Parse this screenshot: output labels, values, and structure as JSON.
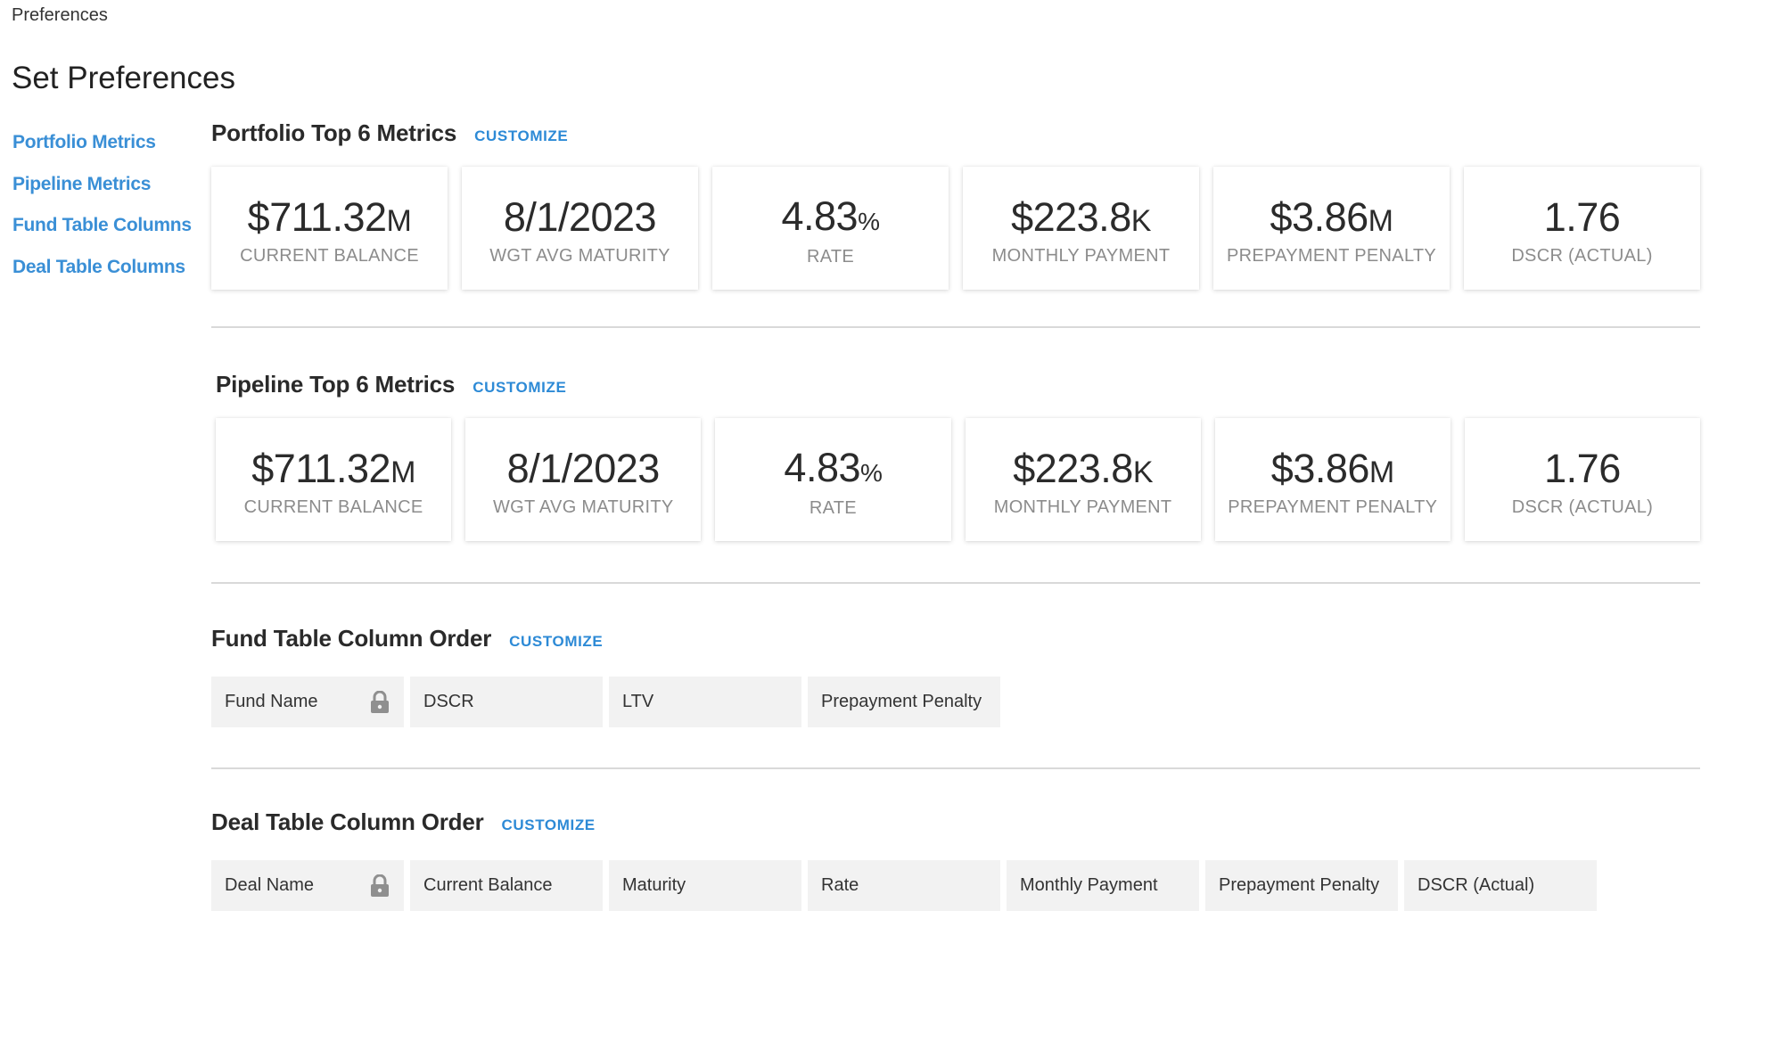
{
  "app": {
    "title": "Preferences"
  },
  "page": {
    "title": "Set Preferences"
  },
  "sidebar": {
    "items": [
      {
        "label": "Portfolio Metrics"
      },
      {
        "label": "Pipeline Metrics"
      },
      {
        "label": "Fund Table Columns"
      },
      {
        "label": "Deal Table Columns"
      }
    ]
  },
  "portfolio": {
    "title": "Portfolio Top 6 Metrics",
    "customize_label": "CUSTOMIZE",
    "metrics": [
      {
        "value": "$711.32",
        "suffix": "M",
        "label": "CURRENT BALANCE"
      },
      {
        "value": "8/1/2023",
        "suffix": "",
        "label": "WGT AVG MATURITY"
      },
      {
        "value": "4.83",
        "suffix": "%",
        "label": "RATE"
      },
      {
        "value": "$223.8",
        "suffix": "K",
        "label": "MONTHLY PAYMENT"
      },
      {
        "value": "$3.86",
        "suffix": "M",
        "label": "PREPAYMENT PENALTY"
      },
      {
        "value": "1.76",
        "suffix": "",
        "label": "DSCR (ACTUAL)"
      }
    ]
  },
  "pipeline": {
    "title": "Pipeline Top 6 Metrics",
    "customize_label": "CUSTOMIZE",
    "metrics": [
      {
        "value": "$711.32",
        "suffix": "M",
        "label": "CURRENT BALANCE"
      },
      {
        "value": "8/1/2023",
        "suffix": "",
        "label": "WGT AVG MATURITY"
      },
      {
        "value": "4.83",
        "suffix": "%",
        "label": "RATE"
      },
      {
        "value": "$223.8",
        "suffix": "K",
        "label": "MONTHLY PAYMENT"
      },
      {
        "value": "$3.86",
        "suffix": "M",
        "label": "PREPAYMENT PENALTY"
      },
      {
        "value": "1.76",
        "suffix": "",
        "label": "DSCR (ACTUAL)"
      }
    ]
  },
  "fund_columns": {
    "title": "Fund Table Column Order",
    "customize_label": "CUSTOMIZE",
    "columns": [
      {
        "label": "Fund Name",
        "locked": true,
        "icon": "lock-icon"
      },
      {
        "label": "DSCR",
        "locked": false
      },
      {
        "label": "LTV",
        "locked": false
      },
      {
        "label": "Prepayment Penalty",
        "locked": false
      }
    ]
  },
  "deal_columns": {
    "title": "Deal Table Column Order",
    "customize_label": "CUSTOMIZE",
    "columns": [
      {
        "label": "Deal Name",
        "locked": true,
        "icon": "lock-icon"
      },
      {
        "label": "Current Balance",
        "locked": false
      },
      {
        "label": "Maturity",
        "locked": false
      },
      {
        "label": "Rate",
        "locked": false
      },
      {
        "label": "Monthly Payment",
        "locked": false
      },
      {
        "label": "Prepayment Penalty",
        "locked": false
      },
      {
        "label": "DSCR (Actual)",
        "locked": false
      }
    ]
  },
  "colors": {
    "link": "#3a8fd6",
    "customize": "#2d8ad6",
    "chip_bg": "#f2f2f2",
    "muted_label": "#8c8c8c",
    "divider": "#d9d9d9"
  }
}
